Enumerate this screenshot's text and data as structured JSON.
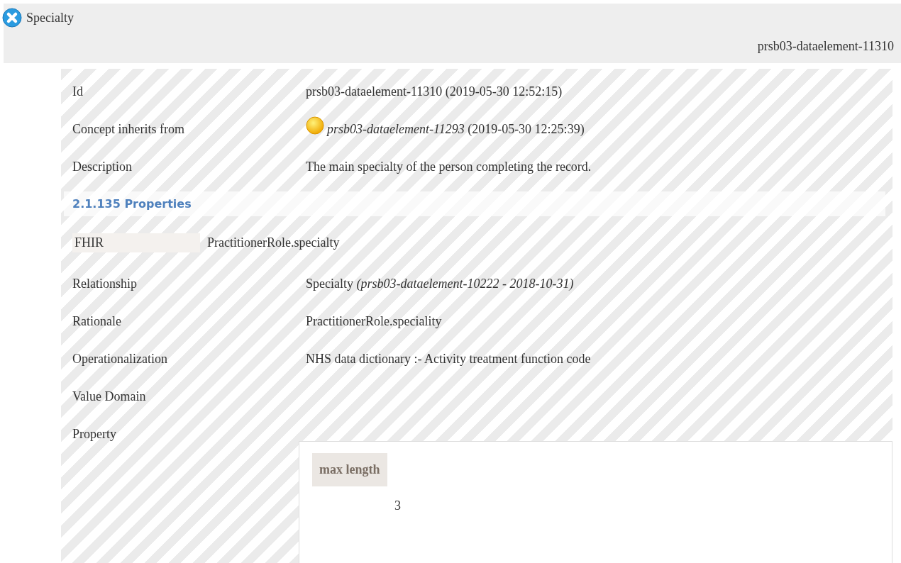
{
  "header": {
    "title": "Specialty",
    "id": "prsb03-dataelement-11310"
  },
  "details": [
    {
      "kind": "text",
      "label": "Id",
      "value": "prsb03-dataelement-11310 (2019-05-30 12:52:15)"
    },
    {
      "kind": "inherit",
      "label": "Concept inherits from",
      "value": "*prsb03-dataelement-11293* (2019-05-30 12:25:39)"
    },
    {
      "kind": "text",
      "label": "Description",
      "value": "The main specialty of the person completing the record."
    }
  ],
  "properties": {
    "heading": "2.1.135 Properties",
    "mapping": {
      "label": "FHIR",
      "value": "PractitionerRole.specialty"
    },
    "rows": [
      {
        "label": "Relationship",
        "value": "Specialty *(prsb03-dataelement-10222 - 2018-10-31)*"
      },
      {
        "label": "Rationale",
        "value": "PractitionerRole.speciality"
      },
      {
        "label": "Operationalization",
        "value": "NHS data dictionary :- Activity treatment function code"
      },
      {
        "label": "Value Domain",
        "value": ""
      }
    ],
    "property": {
      "label": "Property",
      "column": "max length",
      "value": "3"
    }
  }
}
